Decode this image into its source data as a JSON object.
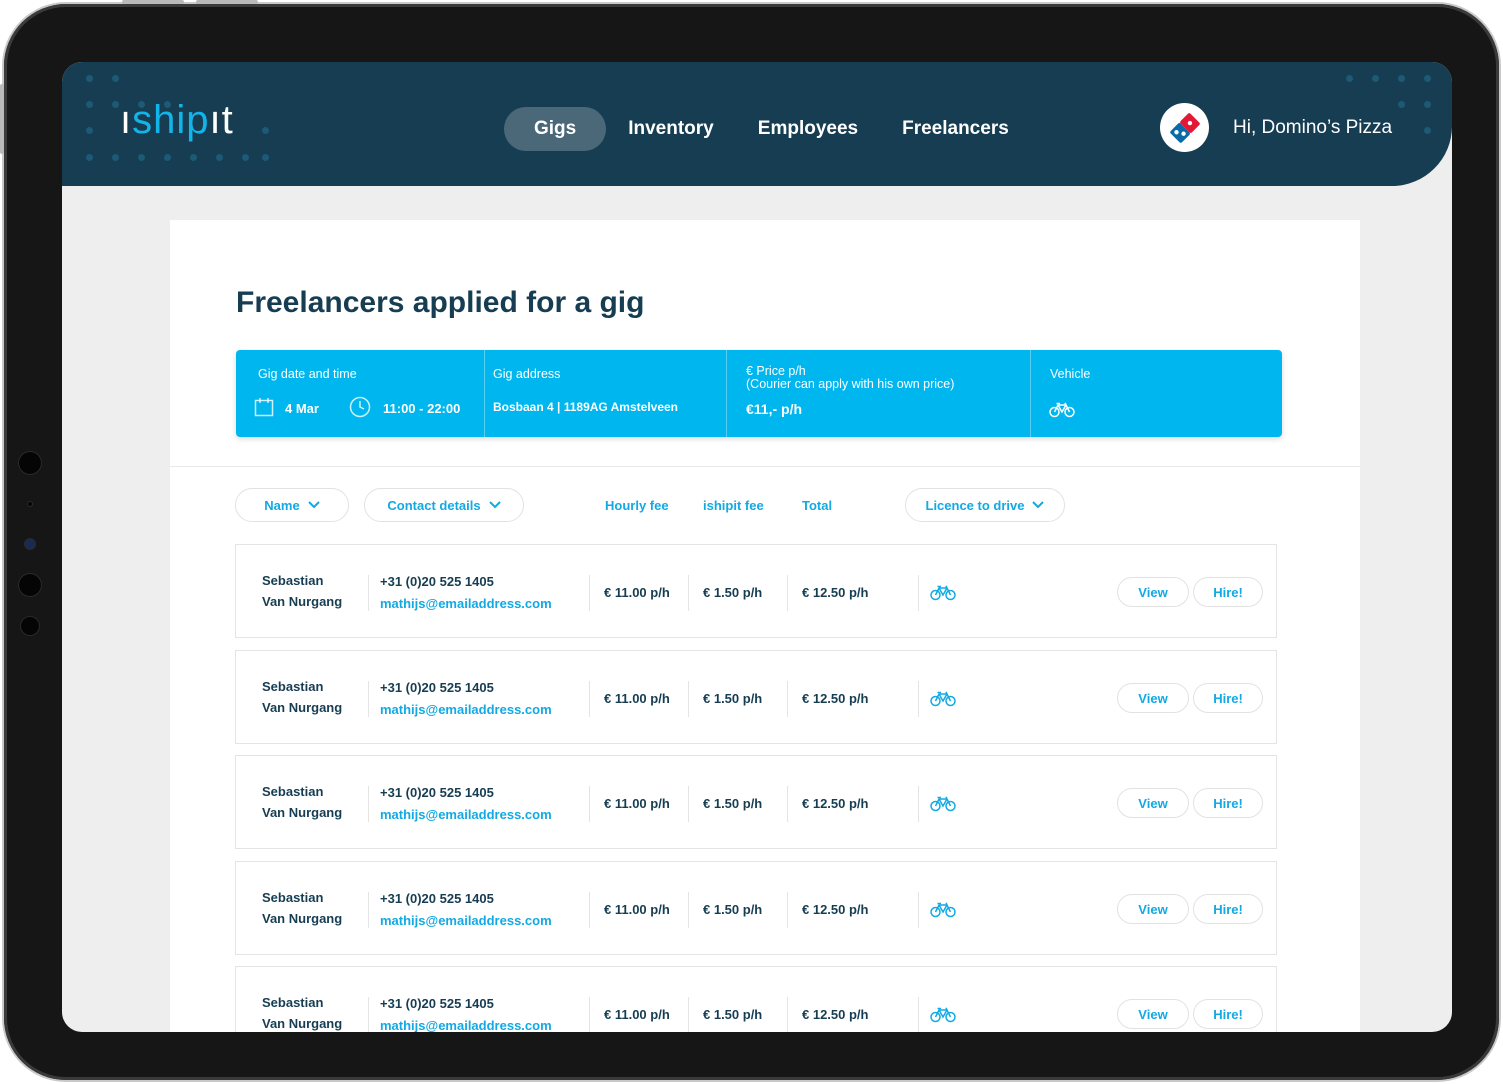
{
  "logo": {
    "text_pre": "ı",
    "text_mid": "ship",
    "text_post": "ıt"
  },
  "nav": [
    {
      "label": "Gigs",
      "active": true
    },
    {
      "label": "Inventory",
      "active": false
    },
    {
      "label": "Employees",
      "active": false
    },
    {
      "label": "Freelancers",
      "active": false
    }
  ],
  "user": {
    "greeting": "Hi, Domino’s Pizza",
    "avatar_icon": "dominos-logo-icon"
  },
  "page": {
    "title": "Freelancers applied for a gig"
  },
  "gig": {
    "date_time_label": "Gig date and time",
    "date": "4 Mar",
    "time": "11:00 - 22:00",
    "address_label": "Gig address",
    "address": "Bosbaan 4 | 1189AG Amstelveen",
    "price_label": "€ Price p/h",
    "price_note": "(Courier can apply with his own price)",
    "price": "€11,- p/h",
    "vehicle_label": "Vehicle",
    "vehicle_icon": "bicycle-icon"
  },
  "filters": {
    "name": "Name",
    "contact": "Contact details",
    "hourly_fee": "Hourly fee",
    "ishipit_fee": "ishipit fee",
    "total": "Total",
    "licence": "Licence to drive"
  },
  "rows": [
    {
      "first": "Sebastian",
      "last": "Van Nurgang",
      "phone": "+31 (0)20 525 1405",
      "email": "mathijs@emailaddress.com",
      "hourly": "€ 11.00 p/h",
      "fee": "€ 1.50 p/h",
      "total": "€ 12.50 p/h",
      "view": "View",
      "hire": "Hire!"
    },
    {
      "first": "Sebastian",
      "last": "Van Nurgang",
      "phone": "+31 (0)20 525 1405",
      "email": "mathijs@emailaddress.com",
      "hourly": "€ 11.00 p/h",
      "fee": "€ 1.50 p/h",
      "total": "€ 12.50 p/h",
      "view": "View",
      "hire": "Hire!"
    },
    {
      "first": "Sebastian",
      "last": "Van Nurgang",
      "phone": "+31 (0)20 525 1405",
      "email": "mathijs@emailaddress.com",
      "hourly": "€ 11.00 p/h",
      "fee": "€ 1.50 p/h",
      "total": "€ 12.50 p/h",
      "view": "View",
      "hire": "Hire!"
    },
    {
      "first": "Sebastian",
      "last": "Van Nurgang",
      "phone": "+31 (0)20 525 1405",
      "email": "mathijs@emailaddress.com",
      "hourly": "€ 11.00 p/h",
      "fee": "€ 1.50 p/h",
      "total": "€ 12.50 p/h",
      "view": "View",
      "hire": "Hire!"
    },
    {
      "first": "Sebastian",
      "last": "Van Nurgang",
      "phone": "+31 (0)20 525 1405",
      "email": "mathijs@emailaddress.com",
      "hourly": "€ 11.00 p/h",
      "fee": "€ 1.50 p/h",
      "total": "€ 12.50 p/h",
      "view": "View",
      "hire": "Hire!"
    }
  ],
  "colors": {
    "navy": "#163d52",
    "accent": "#00b6ef",
    "link": "#12a9e4"
  }
}
